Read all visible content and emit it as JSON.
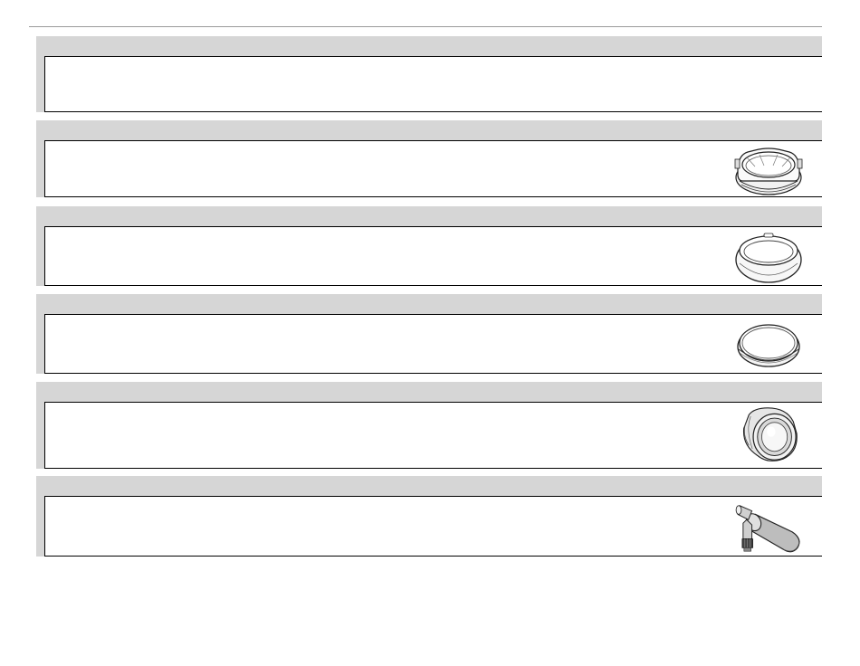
{
  "page": {
    "entries": [
      {
        "id": "entry-1",
        "icon": ""
      },
      {
        "id": "entry-2",
        "icon": "lens-hood-petal-icon"
      },
      {
        "id": "entry-3",
        "icon": "lens-hood-round-icon"
      },
      {
        "id": "entry-4",
        "icon": "adapter-ring-icon"
      },
      {
        "id": "entry-5",
        "icon": "conversion-lens-icon"
      },
      {
        "id": "entry-6",
        "icon": "stereo-microphone-icon"
      }
    ],
    "colors": {
      "header_band": "#d6d6d6",
      "rule": "#000000",
      "top_rule": "#9a9a9a"
    }
  }
}
